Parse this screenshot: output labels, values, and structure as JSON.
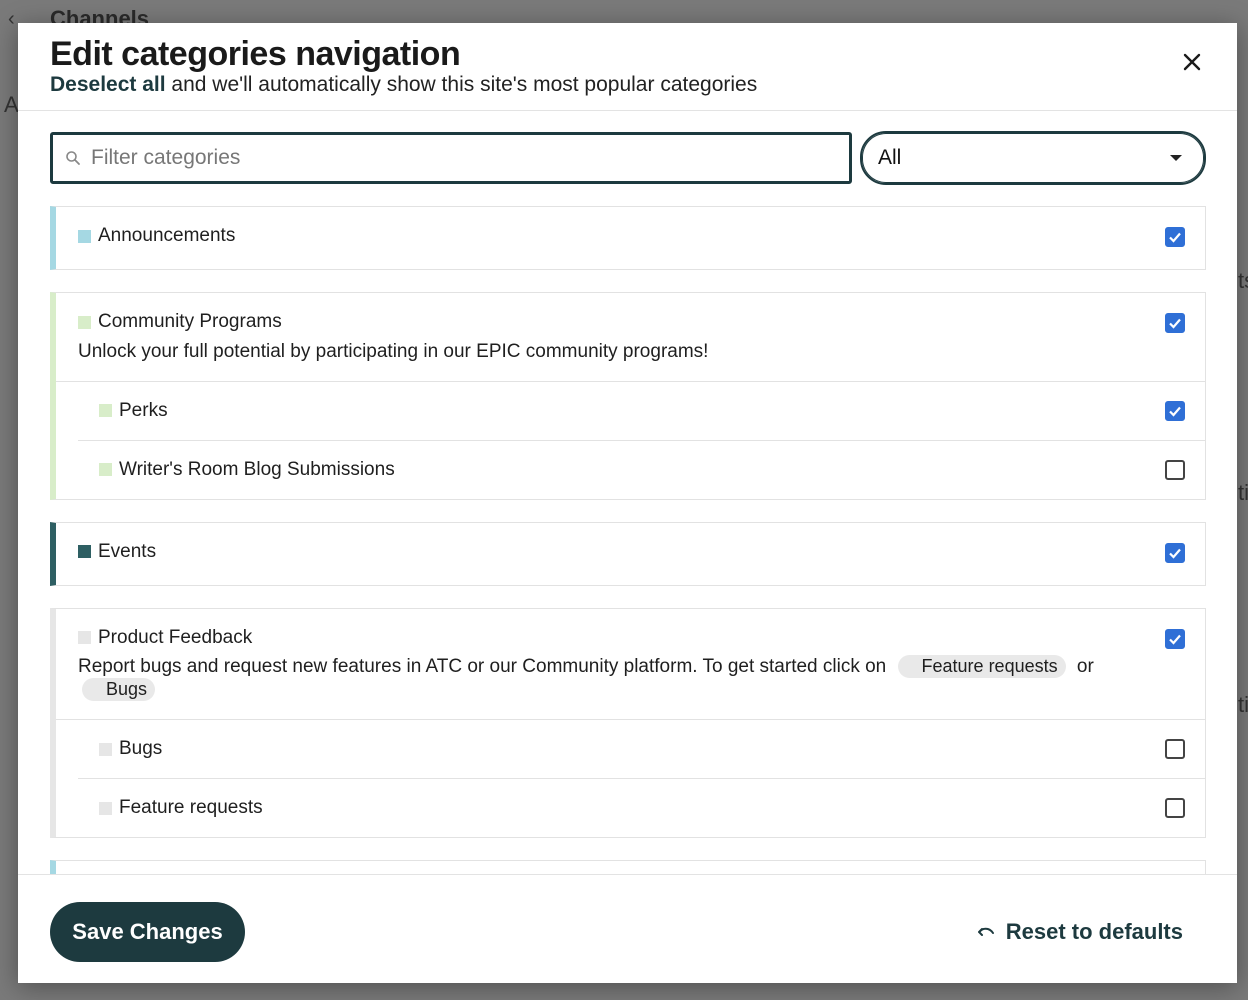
{
  "background": {
    "title": "Channels",
    "fragments": [
      "A",
      "ts",
      "ti",
      "ti"
    ]
  },
  "modal": {
    "title": "Edit categories navigation",
    "subtitle_link": "Deselect all",
    "subtitle_rest": " and we'll automatically show this site's most popular categories",
    "filter_placeholder": "Filter categories",
    "select_value": "All"
  },
  "categories": {
    "announcements": {
      "name": "Announcements",
      "color": "#a5d8e3",
      "checked": true
    },
    "community": {
      "name": "Community Programs",
      "color": "#d8edc9",
      "checked": true,
      "description": "Unlock your full potential by participating in our EPIC community programs!",
      "children": [
        {
          "name": "Perks",
          "checked": true
        },
        {
          "name": "Writer's Room Blog Submissions",
          "checked": false
        }
      ]
    },
    "events": {
      "name": "Events",
      "color": "#2e5f63",
      "checked": true
    },
    "product_feedback": {
      "name": "Product Feedback",
      "color": "#e6e6e6",
      "checked": true,
      "description_pre": "Report bugs and request new features in ATC or our Community platform. To get started click on",
      "pill_1": "Feature requests",
      "description_mid": "or",
      "pill_2": "Bugs",
      "children": [
        {
          "name": "Bugs",
          "checked": false
        },
        {
          "name": "Feature requests",
          "checked": false
        }
      ]
    }
  },
  "footer": {
    "save_label": "Save Changes",
    "reset_label": "Reset to defaults"
  },
  "colors": {
    "accent": "#1d3a3f",
    "checkbox": "#2f6fd6"
  }
}
